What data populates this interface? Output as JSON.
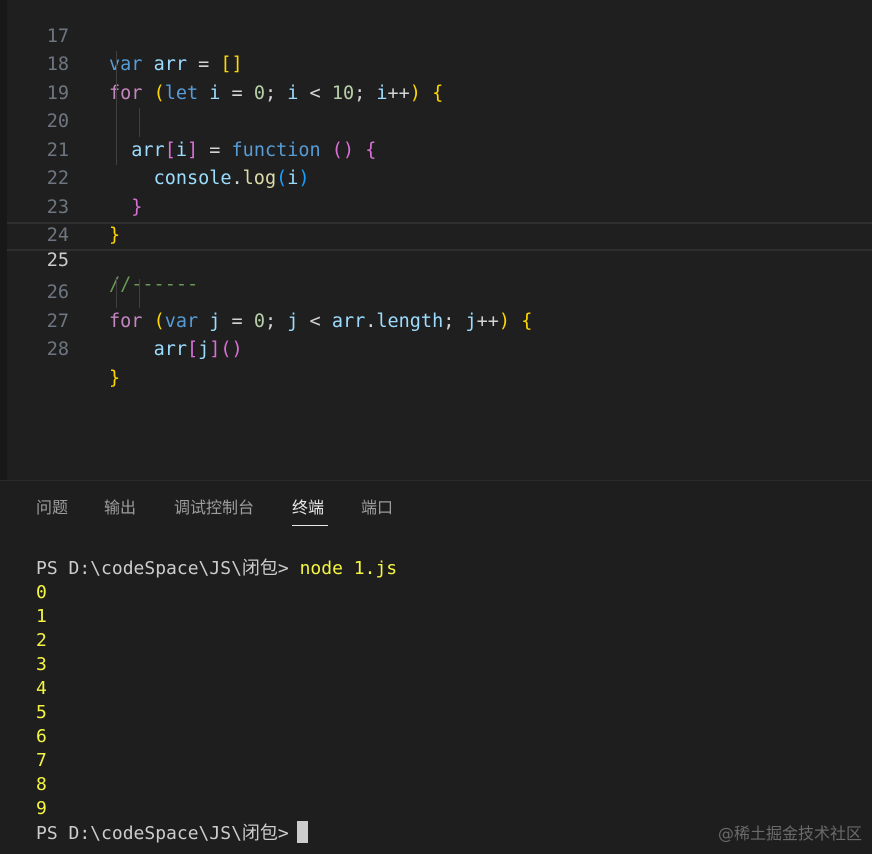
{
  "editor": {
    "line_numbers": [
      "17",
      "18",
      "19",
      "20",
      "21",
      "22",
      "23",
      "24",
      "25",
      "26",
      "27",
      "28"
    ],
    "current_line": "25"
  },
  "panel": {
    "tabs": [
      {
        "label": "问题"
      },
      {
        "label": "输出"
      },
      {
        "label": "调试控制台"
      },
      {
        "label": "终端",
        "active": true
      },
      {
        "label": "端口"
      }
    ]
  },
  "terminal": {
    "prompt": "PS D:\\codeSpace\\JS\\闭包>",
    "command": "node 1.js",
    "output": [
      "0",
      "1",
      "2",
      "3",
      "4",
      "5",
      "6",
      "7",
      "8",
      "9"
    ]
  },
  "watermark": "@稀土掘金技术社区",
  "colors": {
    "keyword_control": "#c586c0",
    "keyword_storage": "#569cd6",
    "variable": "#9cdcfe",
    "function": "#dcdcaa",
    "number": "#b5cea8",
    "comment": "#6a9955",
    "bracket_1": "#ffd700",
    "bracket_2": "#da70d6",
    "bracket_3": "#179fff",
    "terminal_yellow": "#f5f543"
  }
}
